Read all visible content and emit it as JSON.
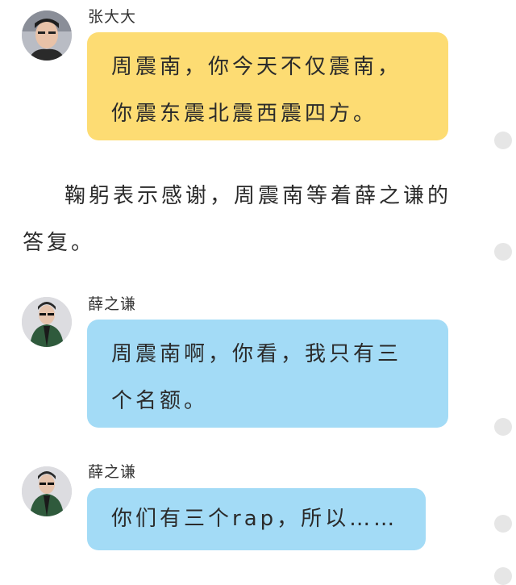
{
  "messages": [
    {
      "sender": "张大大",
      "lines": [
        "周震南，你今天不仅震南，",
        "你震东震北震西震四方。"
      ],
      "color": "#fddc73",
      "avatar_icon": "person-avatar-icon"
    },
    {
      "sender": "薛之谦",
      "lines": [
        "周震南啊，你看，我只有三",
        "个名额。"
      ],
      "color": "#a3dbf6",
      "avatar_icon": "person-avatar-icon"
    },
    {
      "sender": "薛之谦",
      "lines": [
        "你们有三个rap，所以……"
      ],
      "color": "#a3dbf6",
      "avatar_icon": "person-avatar-icon"
    }
  ],
  "narration": {
    "text": "鞠躬表示感谢，周震南等着薛之谦的答复。"
  },
  "scroll_dots": 5
}
